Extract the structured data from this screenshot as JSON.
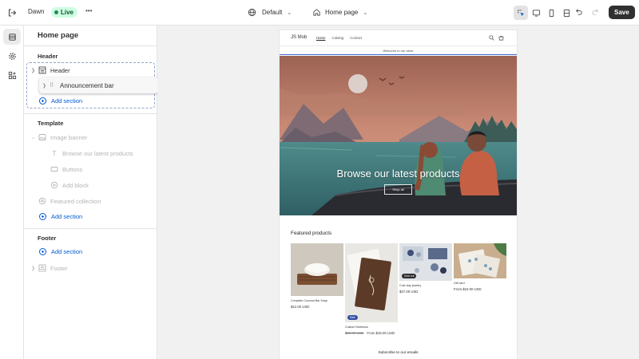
{
  "topbar": {
    "theme_name": "Dawn",
    "status": "Live",
    "market_label": "Default",
    "page_label": "Home page",
    "save_label": "Save"
  },
  "sidebar": {
    "title": "Home page",
    "header_group": {
      "label": "Header",
      "items": [
        {
          "label": "Header"
        },
        {
          "label": "Announcement bar",
          "state": "dragging"
        }
      ],
      "add_label": "Add section"
    },
    "template_group": {
      "label": "Template",
      "section": {
        "label": "Image banner",
        "blocks": [
          {
            "label": "Browse our latest products",
            "icon": "text-icon"
          },
          {
            "label": "Buttons",
            "icon": "button-icon"
          },
          {
            "label": "Add block",
            "icon": "plus-icon"
          }
        ]
      },
      "featured": {
        "label": "Featured collection"
      },
      "add_label": "Add section"
    },
    "footer_group": {
      "label": "Footer",
      "add_label": "Add section",
      "items": [
        {
          "label": "Footer"
        }
      ]
    }
  },
  "preview": {
    "store_name": "JS Mob",
    "nav_links": [
      "Home",
      "Catalog",
      "Contact"
    ],
    "announcement": "Welcome to our store",
    "hero_title": "Browse our latest products",
    "hero_button": "Shop all",
    "featured_title": "Featured products",
    "products": [
      {
        "name": "Complete Coconut Bar Soap",
        "price": "$12.00 USD",
        "compare_price": "",
        "badge": ""
      },
      {
        "name": "Custom Notebook",
        "price": "From $15.00 USD",
        "compare_price": "$20.00 USD",
        "badge": "Sale"
      },
      {
        "name": "Cute clay jewelry",
        "price": "$27.00 USD",
        "compare_price": "",
        "badge": "Sold out"
      },
      {
        "name": "Gift card",
        "price": "From $10.00 USD",
        "compare_price": "",
        "badge": ""
      }
    ],
    "subscribe_title": "Subscribe to our emails"
  },
  "colors": {
    "accent_blue": "#005bd3",
    "live_badge_bg": "#cdfee1",
    "live_badge_dot": "#29845a",
    "save_button": "#303030",
    "announcement_underline": "#3e67d3",
    "sale_badge": "#3650a6"
  }
}
